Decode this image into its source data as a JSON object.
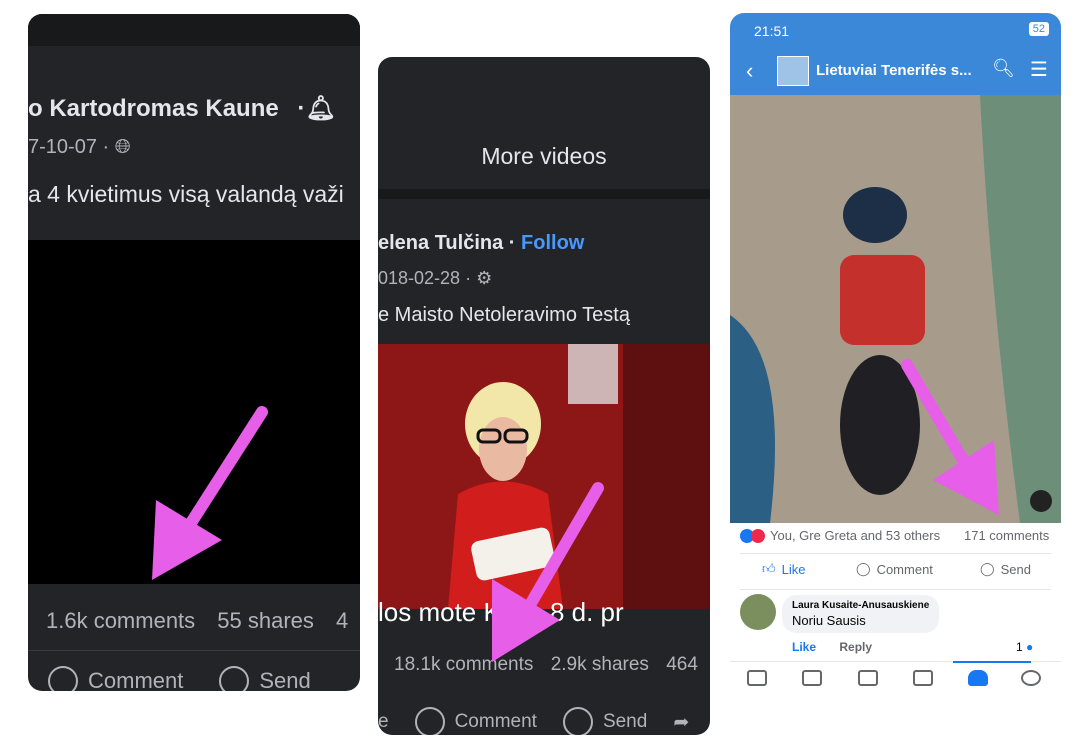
{
  "panel1": {
    "page_name": "o Kartodromas Kaune",
    "date": "7-10-07 ·",
    "post_text": "a 4 kvietimus visą valandą važi",
    "comments": "1.6k comments",
    "shares": "55 shares",
    "share_suffix": "4",
    "comment_label": "Comment",
    "send_label": "Send"
  },
  "panel2": {
    "more_videos": "More videos",
    "author": "elena Tulčina",
    "follow": "Follow",
    "date": "018-02-28 ·",
    "post_text": "e Maisto Netoleravimo Testą",
    "video_caption": "los mote    Kovo 8 d. pr",
    "comments": "18.1k comments",
    "shares": "2.9k shares",
    "views_suffix": "464",
    "left_fragment": "e",
    "comment_label": "Comment",
    "send_label": "Send"
  },
  "panel3": {
    "time": "21:51",
    "battery": "52",
    "group_title": "Lietuviai Tenerifės s...",
    "reactions_text": "You, Gre Greta and 53 others",
    "comments_count": "171 comments",
    "like_label": "Like",
    "comment_label": "Comment",
    "send_label": "Send",
    "commenter": "Laura Kusaite-Anusauskiene",
    "comment_text": "Noriu Sausis",
    "comment_like": "Like",
    "comment_reply": "Reply",
    "comment_like_count": "1"
  },
  "colors": {
    "arrow": "#e75ee8",
    "fb_blue": "#1877f2",
    "dark_bg": "#232427"
  }
}
